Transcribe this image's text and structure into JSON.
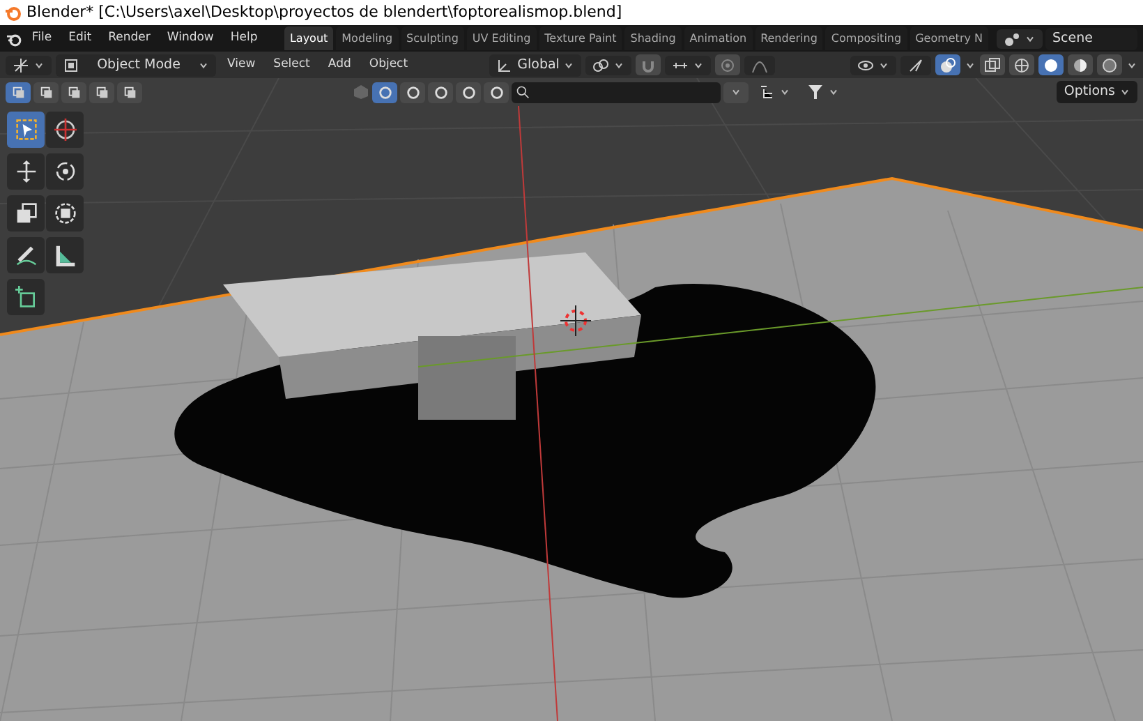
{
  "window": {
    "title": "Blender* [C:\\Users\\axel\\Desktop\\proyectos de blendert\\foptorealismop.blend]"
  },
  "menu": [
    "File",
    "Edit",
    "Render",
    "Window",
    "Help"
  ],
  "workspaces": [
    {
      "label": "Layout",
      "selected": true
    },
    {
      "label": "Modeling",
      "selected": false
    },
    {
      "label": "Sculpting",
      "selected": false
    },
    {
      "label": "UV Editing",
      "selected": false
    },
    {
      "label": "Texture Paint",
      "selected": false
    },
    {
      "label": "Shading",
      "selected": false
    },
    {
      "label": "Animation",
      "selected": false
    },
    {
      "label": "Rendering",
      "selected": false
    },
    {
      "label": "Compositing",
      "selected": false
    },
    {
      "label": "Geometry N",
      "selected": false
    }
  ],
  "scene": {
    "value": "Scene"
  },
  "header": {
    "mode": "Object Mode",
    "menu": [
      "View",
      "Select",
      "Add",
      "Object"
    ],
    "orientation": "Global",
    "shading": [
      {
        "selected": false
      },
      {
        "selected": true
      },
      {
        "selected": false
      },
      {
        "selected": false
      }
    ]
  },
  "tool_header": {
    "select_modes": [
      {
        "selected": true
      },
      {
        "selected": false
      },
      {
        "selected": false
      },
      {
        "selected": false
      },
      {
        "selected": false
      }
    ],
    "filters": [
      {
        "selected": true
      },
      {
        "selected": false
      },
      {
        "selected": false
      },
      {
        "selected": false
      },
      {
        "selected": false
      }
    ],
    "options": "Options"
  },
  "toolbar": [
    {
      "selected": true
    },
    {
      "selected": false
    },
    {
      "selected": false
    },
    {
      "selected": false
    },
    {
      "selected": false
    },
    {
      "selected": false
    },
    {
      "selected": false
    },
    {
      "selected": false
    },
    {
      "selected": false
    }
  ]
}
